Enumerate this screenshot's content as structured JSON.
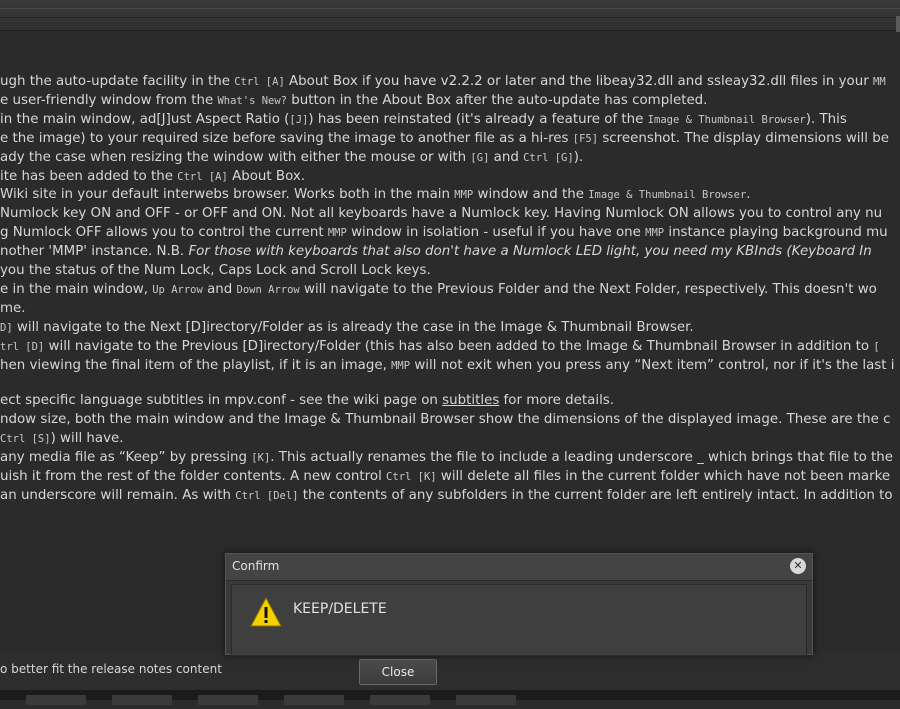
{
  "lines": [
    {
      "y": 0,
      "parts": [
        {
          "t": "ugh the auto-update facility in the "
        },
        {
          "t": "Ctrl [A]",
          "c": "mono"
        },
        {
          "t": " About Box if you have v2.2.2 or later and the libeay32.dll and ssleay32.dll files in your "
        },
        {
          "t": "MM",
          "c": "mono"
        }
      ]
    },
    {
      "y": 1,
      "parts": [
        {
          "t": "e user-friendly window from the "
        },
        {
          "t": "What's New?",
          "c": "mono"
        },
        {
          "t": " button in the About Box after the auto-update has completed."
        }
      ]
    },
    {
      "y": 2,
      "parts": [
        {
          "t": "in the main window, ad[J]ust Aspect Ratio ("
        },
        {
          "t": "[J]",
          "c": "mono"
        },
        {
          "t": ") has been reinstated (it's already a feature of the "
        },
        {
          "t": "Image & Thumbnail Browser",
          "c": "mono"
        },
        {
          "t": "). This "
        }
      ]
    },
    {
      "y": 3,
      "parts": [
        {
          "t": "e the image) to your required size before saving the image to another file as a hi-res "
        },
        {
          "t": "[F5]",
          "c": "mono"
        },
        {
          "t": " screenshot. The display dimensions will be"
        }
      ]
    },
    {
      "y": 4,
      "parts": [
        {
          "t": "ady the case when resizing the window with either the mouse or with "
        },
        {
          "t": "[G]",
          "c": "mono"
        },
        {
          "t": " and "
        },
        {
          "t": "Ctrl [G]",
          "c": "mono"
        },
        {
          "t": ")."
        }
      ]
    },
    {
      "y": 5,
      "parts": [
        {
          "t": "ite has been added to the "
        },
        {
          "t": "Ctrl [A]",
          "c": "mono"
        },
        {
          "t": " About Box."
        }
      ]
    },
    {
      "y": 6,
      "parts": [
        {
          "t": " Wiki site in your default interwebs browser. Works both in the main "
        },
        {
          "t": "MMP",
          "c": "mono"
        },
        {
          "t": " window and the "
        },
        {
          "t": "Image & Thumbnail Browser",
          "c": "mono"
        },
        {
          "t": "."
        }
      ]
    },
    {
      "y": 7,
      "parts": [
        {
          "t": "Numlock key ON and OFF - or OFF and ON. Not all keyboards have a Numlock key. Having Numlock ON allows you to control any nu"
        }
      ]
    },
    {
      "y": 8,
      "parts": [
        {
          "t": "g Numlock OFF allows you to control the current "
        },
        {
          "t": "MMP",
          "c": "mono"
        },
        {
          "t": " window in isolation - useful if you have one "
        },
        {
          "t": "MMP",
          "c": "mono"
        },
        {
          "t": " instance playing background mu"
        }
      ]
    },
    {
      "y": 9,
      "parts": [
        {
          "t": "nother 'MMP' instance. N.B. "
        },
        {
          "t": "For those with keyboards that also don't have a Numlock LED light, you need my KBInds (Keyboard In",
          "c": "it"
        }
      ]
    },
    {
      "y": 10,
      "parts": [
        {
          "t": "you the status of the Num Lock, Caps Lock and Scroll Lock keys."
        }
      ]
    },
    {
      "y": 11,
      "parts": [
        {
          "t": "e in the main window, "
        },
        {
          "t": "Up Arrow",
          "c": "mono"
        },
        {
          "t": " and "
        },
        {
          "t": "Down Arrow",
          "c": "mono"
        },
        {
          "t": " will navigate to the Previous Folder and the Next Folder, respectively. This doesn't wo"
        }
      ]
    },
    {
      "y": 12,
      "parts": [
        {
          "t": "me."
        }
      ]
    },
    {
      "y": 13,
      "parts": [
        {
          "t": "D]",
          "c": "mono"
        },
        {
          "t": " will navigate to the Next [D]irectory/Folder as is already the case in the Image & Thumbnail Browser."
        }
      ]
    },
    {
      "y": 14,
      "parts": [
        {
          "t": "trl [D]",
          "c": "mono"
        },
        {
          "t": " will navigate to the Previous [D]irectory/Folder (this has also been added to the Image & Thumbnail Browser in addition to "
        },
        {
          "t": "[",
          "c": "mono"
        }
      ]
    },
    {
      "y": 15,
      "parts": [
        {
          "t": "hen viewing the final item of the playlist, if it is an image, "
        },
        {
          "t": "MMP",
          "c": "mono"
        },
        {
          "t": " will not exit when you press any “Next item” control, nor if it's the last i"
        }
      ]
    },
    {
      "y": 16.9,
      "parts": [
        {
          "t": "ect specific language subtitles in mpv.conf - see the wiki page on "
        },
        {
          "t": "subtitles",
          "c": "u"
        },
        {
          "t": " for more details."
        }
      ]
    },
    {
      "y": 17.9,
      "parts": [
        {
          "t": "ndow size, both the main window and the Image & Thumbnail Browser show the dimensions of the displayed image. These are the c"
        }
      ]
    },
    {
      "y": 18.9,
      "parts": [
        {
          "t": "Ctrl [S]",
          "c": "mono"
        },
        {
          "t": ") will have."
        }
      ]
    },
    {
      "y": 19.9,
      "parts": [
        {
          "t": "any media file as “Keep” by pressing "
        },
        {
          "t": "[K]",
          "c": "mono"
        },
        {
          "t": ". This actually renames the file to include a leading underscore _ which brings that file to the"
        }
      ]
    },
    {
      "y": 20.9,
      "parts": [
        {
          "t": "uish it from the rest of the folder contents. A new control "
        },
        {
          "t": "Ctrl [K]",
          "c": "mono"
        },
        {
          "t": " will delete all files in the current folder which have not been marke"
        }
      ]
    },
    {
      "y": 21.9,
      "parts": [
        {
          "t": "an underscore will remain. As with "
        },
        {
          "t": "Ctrl [Del]",
          "c": "mono"
        },
        {
          "t": " the contents of any subfolders in the current folder are left entirely intact. In addition to"
        }
      ]
    }
  ],
  "footer": {
    "note": "o better fit the release notes content",
    "close_label": "Close"
  },
  "dialog": {
    "title": "Confirm",
    "message": "KEEP/DELETE",
    "icon": "warning-icon"
  }
}
